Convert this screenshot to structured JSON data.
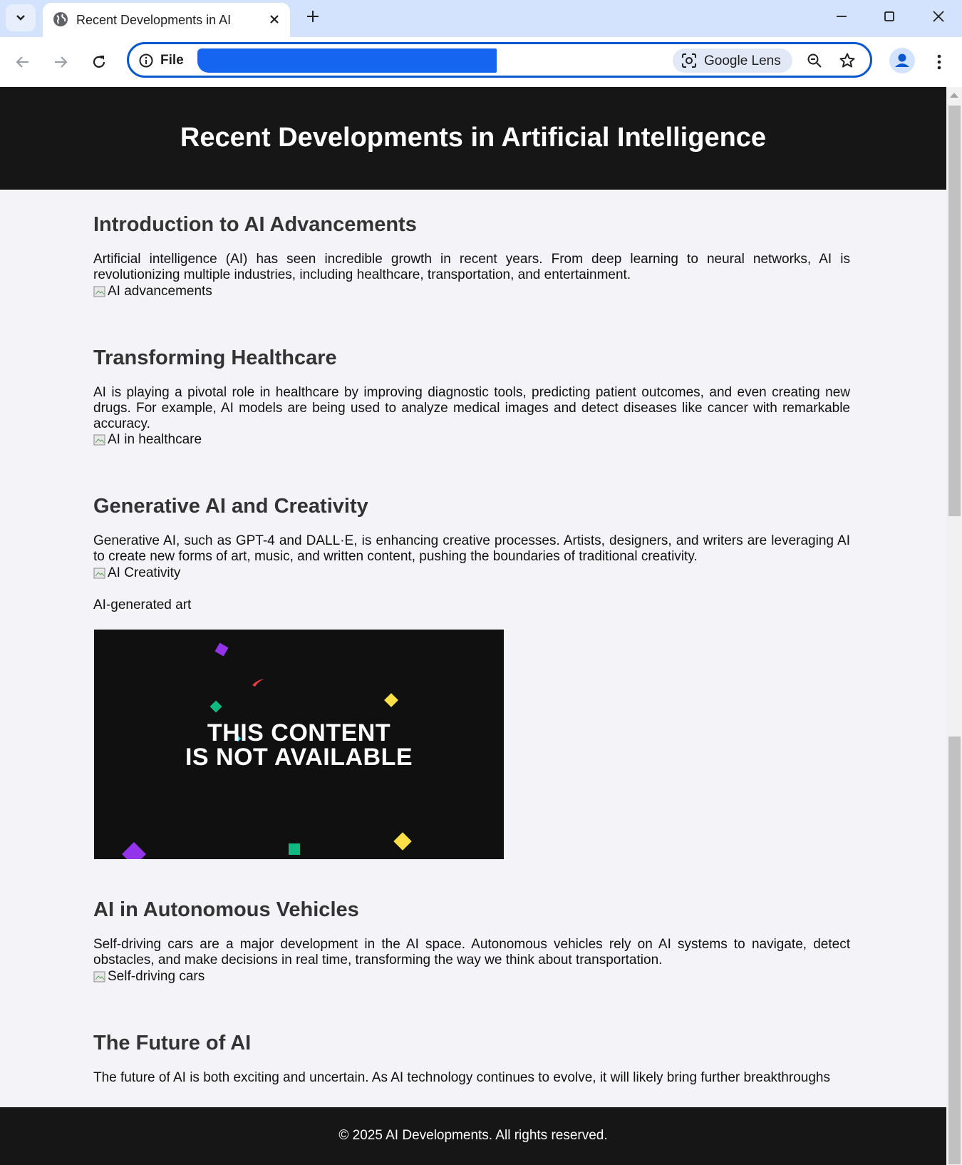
{
  "browser": {
    "tab_title": "Recent Developments in AI",
    "address_scheme": "File",
    "lens_label": "Google Lens",
    "icons": [
      "tab-search-icon",
      "globe-icon",
      "close-icon",
      "plus-icon",
      "minimize-icon",
      "maximize-icon",
      "window-close-icon",
      "back-icon",
      "forward-icon",
      "reload-icon",
      "info-icon",
      "lens-icon",
      "zoom-icon",
      "star-icon",
      "profile-icon",
      "kebab-menu-icon"
    ]
  },
  "page": {
    "header_title": "Recent Developments in Artificial Intelligence",
    "sections": [
      {
        "heading": "Introduction to AI Advancements",
        "text": "Artificial intelligence (AI) has seen incredible growth in recent years. From deep learning to neural networks, AI is revolutionizing multiple industries, including healthcare, transportation, and entertainment.",
        "image_alt": "AI advancements"
      },
      {
        "heading": "Transforming Healthcare",
        "text": "AI is playing a pivotal role in healthcare by improving diagnostic tools, predicting patient outcomes, and even creating new drugs. For example, AI models are being used to analyze medical images and detect diseases like cancer with remarkable accuracy.",
        "image_alt": "AI in healthcare"
      },
      {
        "heading": "Generative AI and Creativity",
        "text": "Generative AI, such as GPT-4 and DALL·E, is enhancing creative processes. Artists, designers, and writers are leveraging AI to create new forms of art, music, and written content, pushing the boundaries of traditional creativity.",
        "image_alt": "AI Creativity",
        "caption": "AI-generated art",
        "video_message_line1": "THIS CONTENT",
        "video_message_line2": "IS NOT AVAILABLE"
      },
      {
        "heading": "AI in Autonomous Vehicles",
        "text": "Self-driving cars are a major development in the AI space. Autonomous vehicles rely on AI systems to navigate, detect obstacles, and make decisions in real time, transforming the way we think about transportation.",
        "image_alt": "Self-driving cars"
      },
      {
        "heading": "The Future of AI",
        "text": "The future of AI is both exciting and uncertain. As AI technology continues to evolve, it will likely bring further breakthroughs"
      }
    ],
    "footer_text": "© 2025 AI Developments. All rights reserved."
  },
  "colors": {
    "header_bg": "#161616",
    "page_bg": "#f4f4f8",
    "accent": "#0b57d0",
    "redaction": "#1565f0"
  }
}
